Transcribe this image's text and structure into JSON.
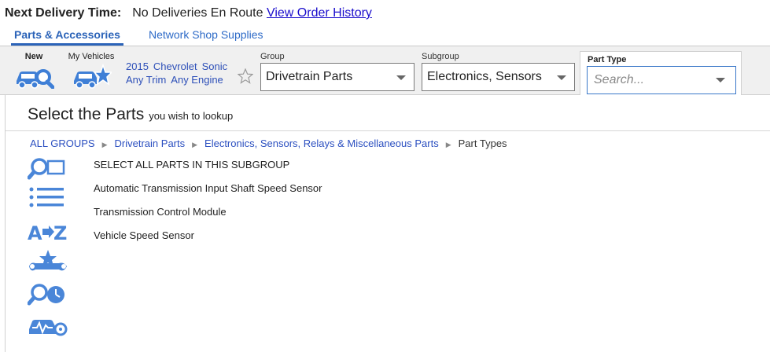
{
  "header": {
    "delivery_label": "Next Delivery Time:",
    "delivery_value": "No Deliveries En Route",
    "order_history_link": "View Order History"
  },
  "tabs": [
    {
      "label": "Parts & Accessories",
      "active": true
    },
    {
      "label": "Network Shop Supplies",
      "active": false
    }
  ],
  "toolbar": {
    "new_label": "New",
    "my_vehicles_label": "My Vehicles",
    "vehicle": {
      "year": "2015",
      "make": "Chevrolet",
      "model": "Sonic",
      "trim": "Any Trim",
      "engine": "Any Engine"
    },
    "group": {
      "label": "Group",
      "value": "Drivetrain Parts"
    },
    "subgroup": {
      "label": "Subgroup",
      "value": "Electronics, Sensors"
    },
    "part_type": {
      "label": "Part Type",
      "placeholder": "Search..."
    }
  },
  "main": {
    "title": "Select the Parts",
    "subtitle": "you wish to lookup",
    "breadcrumb": {
      "items": [
        "ALL GROUPS",
        "Drivetrain Parts",
        "Electronics, Sensors, Relays & Miscellaneous Parts"
      ],
      "current": "Part Types"
    },
    "parts": [
      "SELECT ALL PARTS IN THIS SUBGROUP",
      "Automatic Transmission Input Shaft Speed Sensor",
      "Transmission Control Module",
      "Vehicle Speed Sensor"
    ]
  },
  "colors": {
    "accent": "#2b63b8",
    "icon": "#4a86d8",
    "link": "#1a0dcc"
  }
}
